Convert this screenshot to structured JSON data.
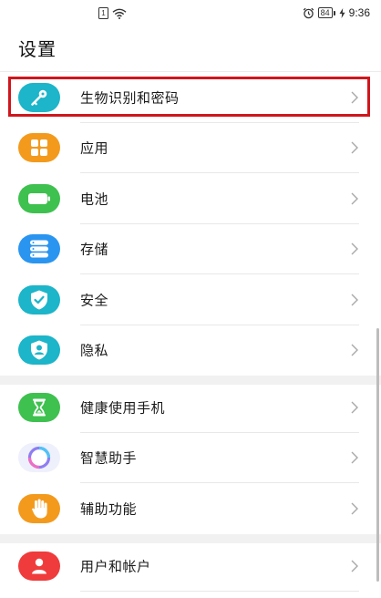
{
  "status_bar": {
    "time": "9:36",
    "battery": "84",
    "sim_label": "1"
  },
  "page": {
    "title": "设置"
  },
  "settings": {
    "group1": [
      {
        "label": "生物识别和密码",
        "icon": "key-icon",
        "color": "#1cb5c9"
      },
      {
        "label": "应用",
        "icon": "apps-grid-icon",
        "color": "#f39a1d"
      },
      {
        "label": "电池",
        "icon": "battery-icon",
        "color": "#3ec14f"
      },
      {
        "label": "存储",
        "icon": "storage-icon",
        "color": "#2a95f0"
      },
      {
        "label": "安全",
        "icon": "shield-check-icon",
        "color": "#1cb5c9"
      },
      {
        "label": "隐私",
        "icon": "privacy-shield-icon",
        "color": "#1cb5c9"
      }
    ],
    "group2": [
      {
        "label": "健康使用手机",
        "icon": "hourglass-icon",
        "color": "#3ec14f"
      },
      {
        "label": "智慧助手",
        "icon": "assistant-ring-icon",
        "color": "#9b7cf0"
      },
      {
        "label": "辅助功能",
        "icon": "hand-icon",
        "color": "#f39a1d"
      }
    ],
    "group3": [
      {
        "label": "用户和帐户",
        "icon": "user-icon",
        "color": "#ef3b3b"
      }
    ]
  }
}
